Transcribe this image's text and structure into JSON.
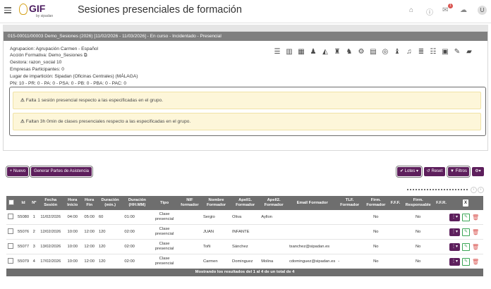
{
  "header": {
    "menu_icon": "hamburger-icon",
    "logo_text": "GIF",
    "logo_sub": "by sipadan",
    "title": "Sesiones presenciales de formación",
    "icons": [
      "home-icon",
      "info-icon",
      "mail-icon",
      "cloud-download-icon"
    ],
    "mail_badge": "1",
    "avatar_letter": "U"
  },
  "panel": {
    "header_text": "015-00011/00003 Demo_Sesiones (2026) [11/02/2026 - 11/03/2026] - En curso - Incidentado - Presencial",
    "agrupacion": "Agrupacion: Agrupación Carmen - Español",
    "accion": "Acción Formativa: Demo_Sesiones",
    "gestora": "Gestora: razon_social 10",
    "empresas": "Empresas Participantes: 0",
    "lugar": "Lugar de impartición: Sipadan (Oficinas Centrales) (MÁLAGA)",
    "status_codes": "PN: 10 - PR: 0 - PA: 0 - PSA: 0 - PB: 0 - PBA: 0 - PAC: 0",
    "action_icons": [
      "list-icon",
      "building-icon",
      "calendar-icon",
      "group-icon",
      "chart-area-icon",
      "users-cog-icon",
      "user-group-icon",
      "gear-icon",
      "file-invoice-icon",
      "coins-icon",
      "user-tie-icon",
      "bell-icon",
      "list-ul-icon",
      "checklist-icon",
      "id-card-icon",
      "file-signature-icon",
      "folder-open-icon"
    ]
  },
  "alerts": [
    "Falta 1 sesión presencial respecto a las especificadas en el grupo.",
    "Faltan 3h 0min de clases presenciales respecto a las especificadas en el grupo."
  ],
  "toolbar": {
    "nuevo_label": "+ Nuevo",
    "generar_label": "Generar Partes de Asistencia",
    "lotes_label": "Lotes",
    "reset_label": "Reset",
    "filtros_label": "Filtros",
    "settings_icon": "gear-icon"
  },
  "table": {
    "columns": [
      "",
      "Id",
      "Nº",
      "Fecha Sesión",
      "Hora Inicio",
      "Hora Fin",
      "Duración (min.)",
      "Duración (HH:MM)",
      "Tipo",
      "NIF formador",
      "Nombre Formador",
      "Apell1. Formador",
      "Apell2. Formador",
      "Email Formador",
      "TLF. Formador",
      "Firm. Formador",
      "F.F.F.",
      "Firm. Responsable",
      "F.F.R.",
      ""
    ],
    "rows": [
      {
        "id": "55080",
        "n": "1",
        "fecha": "11/02/2026",
        "inicio": "04:00",
        "fin": "05:00",
        "min": "60",
        "hhmm": "01:00",
        "tipo": "Clase presencial",
        "nif": "",
        "nombre": "Sergio",
        "ap1": "Oliva",
        "ap2": "Ayllon",
        "email": "",
        "tlf": "",
        "ff": "No",
        "fff": "",
        "fr": "No",
        "ffr": ""
      },
      {
        "id": "55076",
        "n": "2",
        "fecha": "12/02/2026",
        "inicio": "10:00",
        "fin": "12:00",
        "min": "120",
        "hhmm": "02:00",
        "tipo": "Clase presencial",
        "nif": "",
        "nombre": "JUAN",
        "ap1": "INFANTE",
        "ap2": "",
        "email": "",
        "tlf": "",
        "ff": "No",
        "fff": "",
        "fr": "No",
        "ffr": ""
      },
      {
        "id": "55077",
        "n": "3",
        "fecha": "13/02/2026",
        "inicio": "10:00",
        "fin": "12:00",
        "min": "120",
        "hhmm": "02:00",
        "tipo": "Clase presencial",
        "nif": "",
        "nombre": "Toñi",
        "ap1": "Sánchez",
        "ap2": "",
        "email": "tsanchez@sipadan.es",
        "tlf": "",
        "ff": "No",
        "fff": "",
        "fr": "No",
        "ffr": ""
      },
      {
        "id": "55079",
        "n": "4",
        "fecha": "17/02/2026",
        "inicio": "10:00",
        "fin": "12:00",
        "min": "120",
        "hhmm": "02:00",
        "tipo": "Clase presencial",
        "nif": "",
        "nombre": "Carmen",
        "ap1": "Dominguez",
        "ap2": "Molina",
        "email": "cdominguez@sipadan.es",
        "tlf": "-",
        "ff": "No",
        "fff": "",
        "fr": "No",
        "ffr": ""
      }
    ],
    "footer": "Mostrando los resultados del 1 al 4 de un total de 4"
  }
}
